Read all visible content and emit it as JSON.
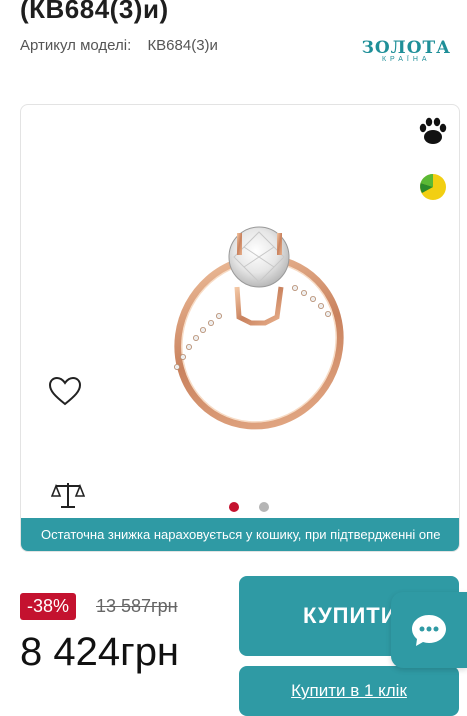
{
  "product": {
    "title": "(КВ684(3)и)",
    "sku_label": "Артикул моделі:",
    "sku_value": "КВ684(3)и"
  },
  "brand": {
    "line1": "ЗОЛОТА",
    "line2": "КРАЇНА"
  },
  "gallery": {
    "notice": "Остаточна знижка нараховується у кошику, при підтвердженні опе",
    "slides": 2,
    "active_slide": 1
  },
  "pricing": {
    "discount": "-38%",
    "old_price": "13 587грн",
    "price": "8 424грн"
  },
  "actions": {
    "buy_label": "КУПИТИ",
    "one_click_label": "Купити в 1 клік"
  },
  "colors": {
    "accent": "#2f9aa4",
    "sale": "#c4122f"
  },
  "icons": [
    "paw-icon",
    "pie-chart-icon",
    "heart-icon",
    "scale-icon",
    "chat-icon"
  ]
}
